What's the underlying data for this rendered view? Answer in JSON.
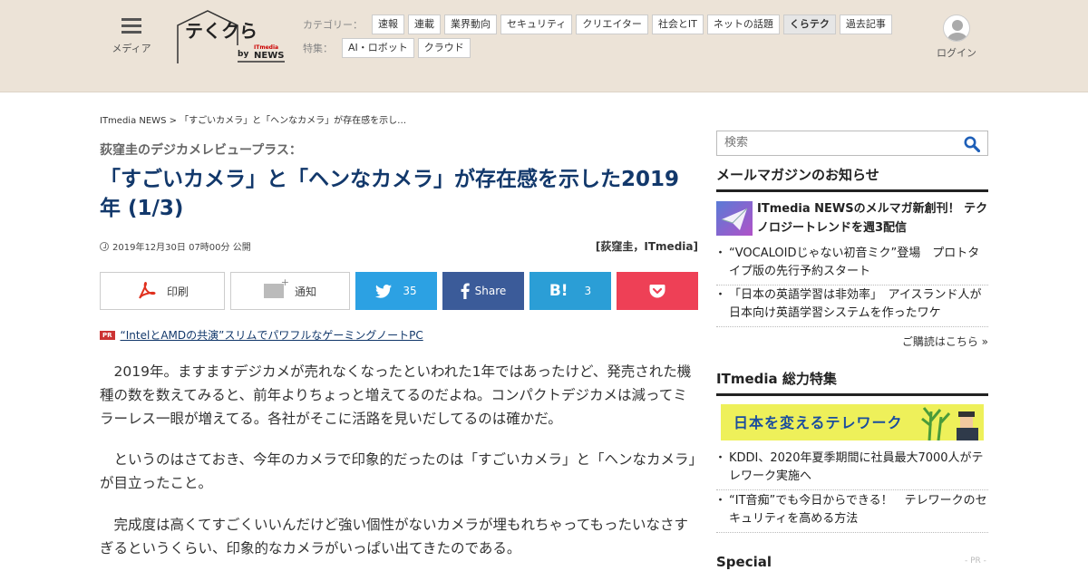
{
  "header": {
    "menu_label": "メディア",
    "logo_text": "テくクら",
    "logo_by": "by",
    "logo_it": "ITmedia",
    "logo_news": "NEWS",
    "category_label": "カテゴリー：",
    "categories": [
      "速報",
      "連載",
      "業界動向",
      "セキュリティ",
      "クリエイター",
      "社会とIT",
      "ネットの話題",
      "くらテク",
      "過去記事"
    ],
    "feature_label": "特集：",
    "features": [
      "AI・ロボット",
      "クラウド"
    ],
    "login_label": "ログイン"
  },
  "article": {
    "breadcrumb": "ITmedia NEWS > 「すごいカメラ」と「ヘンなカメラ」が存在感を示し…",
    "series": "荻窪圭のデジカメレビュープラス：",
    "title": "「すごいカメラ」と「ヘンなカメラ」が存在感を示した2019年 (1/3)",
    "date": "2019年12月30日 07時00分 公開",
    "byline": "[荻窪圭，ITmedia]",
    "share": {
      "print_label": "印刷",
      "notify_label": "通知",
      "twitter_count": "35",
      "facebook_label": "Share",
      "hatena_count": "3"
    },
    "pr_badge": "PR",
    "pr_text": "“IntelとAMDの共演”スリムでパワフルなゲーミングノートPC",
    "paragraphs": [
      "2019年。ますますデジカメが売れなくなったといわれた1年ではあったけど、発売された機種の数を数えてみると、前年よりちょっと増えてるのだよね。コンパクトデジカメは減ってミラーレス一眼が増えてる。各社がそこに活路を見いだしてるのは確かだ。",
      "というのはさておき、今年のカメラで印象的だったのは「すごいカメラ」と「ヘンなカメラ」が目立ったこと。",
      "完成度は高くてすごくいいんだけど強い個性がないカメラが埋もれちゃってもったいなさすぎるというくらい、印象的なカメラがいっぱい出てきたのである。"
    ]
  },
  "sidebar": {
    "search_placeholder": "検索",
    "newsletter_heading": "メールマガジンのお知らせ",
    "newsletter_title": "ITmedia NEWSのメルマガ新創刊！ テクノロジートレンドを週3配信",
    "newsletter_items": [
      "“VOCALOIDじゃない初音ミク”登場　プロトタイプ版の先行予約スタート",
      "「日本の英語学習は非効率」　アイスランド人が日本向け英語学習システムを作ったワケ"
    ],
    "subscribe_link": "ご購読はこちら »",
    "feature_heading": "ITmedia 総力特集",
    "banner_text": "日本を変えるテレワーク",
    "feature_items": [
      "KDDI、2020年夏季期間に社員最大7000人がテレワーク実施へ",
      "“IT音痴”でも今日からできる！　テレワークのセキュリティを高める方法"
    ],
    "special_heading": "Special",
    "special_pr": "- PR -"
  },
  "colors": {
    "header_bg": "#ece3d7",
    "title_color": "#12386b",
    "twitter": "#2ca1e3",
    "facebook": "#3b5b99",
    "hatena": "#2b9ed6",
    "pocket": "#ee4056"
  }
}
